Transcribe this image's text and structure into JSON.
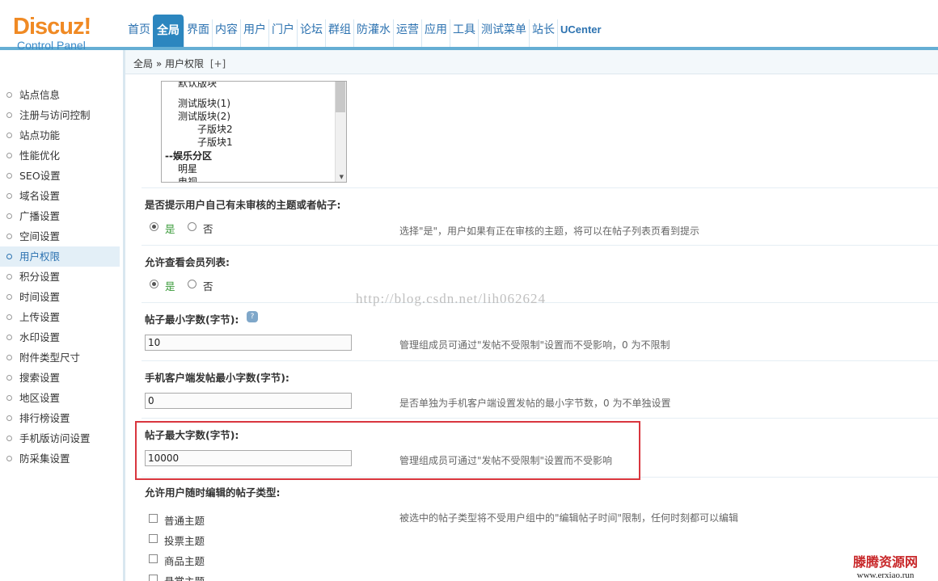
{
  "logo": {
    "title": "Discuz!",
    "subtitle": "Control Panel"
  },
  "nav": [
    "首页",
    "全局",
    "界面",
    "内容",
    "用户",
    "门户",
    "论坛",
    "群组",
    "防灌水",
    "运营",
    "应用",
    "工具",
    "测试菜单",
    "站长",
    "UCenter"
  ],
  "nav_active": "全局",
  "breadcrumb": {
    "text": "全局 » 用户权限",
    "plus": "[+]"
  },
  "sidebar": {
    "items": [
      "站点信息",
      "注册与访问控制",
      "站点功能",
      "性能优化",
      "SEO设置",
      "域名设置",
      "广播设置",
      "空间设置",
      "用户权限",
      "积分设置",
      "时间设置",
      "上传设置",
      "水印设置",
      "附件类型尺寸",
      "搜索设置",
      "地区设置",
      "排行榜设置",
      "手机版访问设置",
      "防采集设置"
    ],
    "active": "用户权限"
  },
  "forum_list": {
    "options": [
      "默认版块",
      "测试版块(1)",
      "测试版块(2)",
      "子版块2",
      "子版块1",
      "--娱乐分区",
      "明星",
      "电视"
    ]
  },
  "sections": {
    "moderation_prompt": {
      "title": "是否提示用户自己有未审核的主题或者帖子:",
      "yes": "是",
      "no": "否",
      "tip": "选择\"是\"，用户如果有正在审核的主题，将可以在帖子列表页看到提示"
    },
    "member_list": {
      "title": "允许查看会员列表:",
      "yes": "是",
      "no": "否"
    },
    "min_chars": {
      "title": "帖子最小字数(字节):",
      "value": "10",
      "tip": "管理组成员可通过\"发帖不受限制\"设置而不受影响，0 为不限制"
    },
    "mobile_min_chars": {
      "title": "手机客户端发帖最小字数(字节):",
      "value": "0",
      "tip": "是否单独为手机客户端设置发帖的最小字节数，0 为不单独设置"
    },
    "max_chars": {
      "title": "帖子最大字数(字节):",
      "value": "10000",
      "tip": "管理组成员可通过\"发帖不受限制\"设置而不受影响"
    },
    "edit_types": {
      "title": "允许用户随时编辑的帖子类型:",
      "tip": "被选中的帖子类型将不受用户组中的\"编辑帖子时间\"限制，任何时刻都可以编辑",
      "options": [
        "普通主题",
        "投票主题",
        "商品主题",
        "悬赏主题"
      ]
    }
  },
  "watermark": "http://blog.csdn.net/lih062624",
  "brand_watermark": {
    "name": "滕腾资源网",
    "url": "www.erxiao.run"
  }
}
